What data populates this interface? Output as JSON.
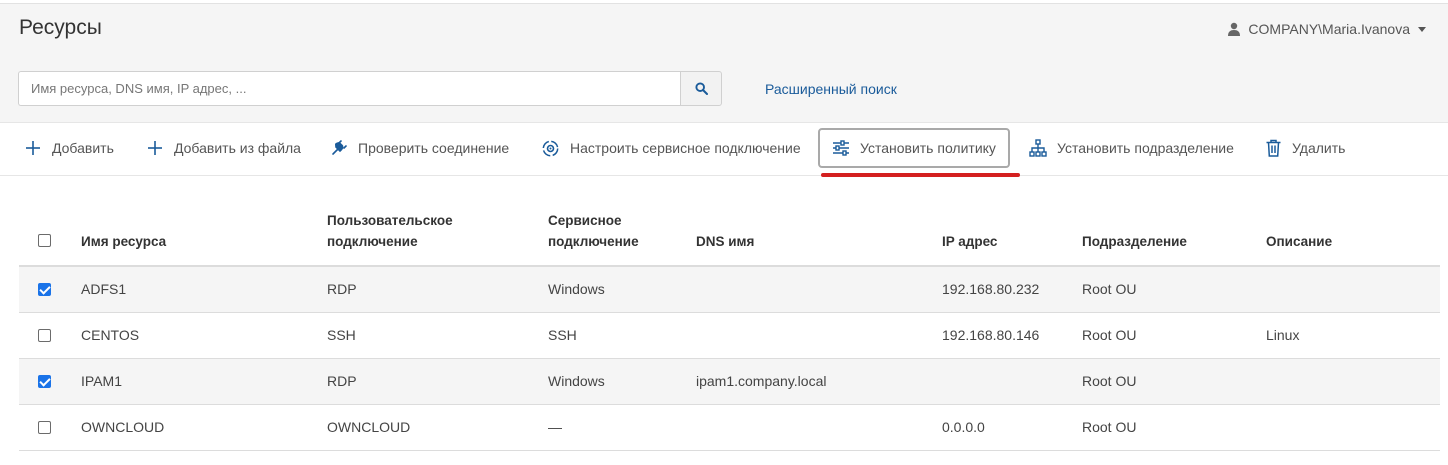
{
  "page": {
    "title": "Ресурсы"
  },
  "user": {
    "name": "COMPANY\\Maria.Ivanova"
  },
  "search": {
    "placeholder": "Имя ресурса, DNS имя, IP адрес, ...",
    "value": "",
    "advanced_label": "Расширенный поиск"
  },
  "toolbar": {
    "add_label": "Добавить",
    "add_from_file_label": "Добавить из файла",
    "check_connection_label": "Проверить соединение",
    "service_connection_label": "Настроить сервисное подключение",
    "set_policy_label": "Установить политику",
    "set_unit_label": "Установить подразделение",
    "delete_label": "Удалить"
  },
  "table": {
    "columns": {
      "name": "Имя ресурса",
      "user_conn_1": "Пользовательское",
      "user_conn_2": "подключение",
      "service_conn_1": "Сервисное",
      "service_conn_2": "подключение",
      "dns": "DNS имя",
      "ip": "IP адрес",
      "unit": "Подразделение",
      "description": "Описание"
    },
    "rows": [
      {
        "checked": true,
        "name": "ADFS1",
        "user_conn": "RDP",
        "service_conn": "Windows",
        "dns": "",
        "ip": "192.168.80.232",
        "unit": "Root OU",
        "description": ""
      },
      {
        "checked": false,
        "name": "CENTOS",
        "user_conn": "SSH",
        "service_conn": "SSH",
        "dns": "",
        "ip": "192.168.80.146",
        "unit": "Root OU",
        "description": "Linux"
      },
      {
        "checked": true,
        "name": "IPAM1",
        "user_conn": "RDP",
        "service_conn": "Windows",
        "dns": "ipam1.company.local",
        "ip": "",
        "unit": "Root OU",
        "description": ""
      },
      {
        "checked": false,
        "name": "OWNCLOUD",
        "user_conn": "OWNCLOUD",
        "service_conn": "—",
        "dns": "",
        "ip": "0.0.0.0",
        "unit": "Root OU",
        "description": ""
      }
    ]
  },
  "colors": {
    "accent": "#1a5b9a",
    "checkbox": "#1a73e8",
    "highlight_underline": "#d42020"
  },
  "icons": [
    "user-icon",
    "search-icon",
    "plus-icon",
    "plug-icon",
    "service-settings-icon",
    "sliders-icon",
    "hierarchy-icon",
    "trash-icon"
  ]
}
